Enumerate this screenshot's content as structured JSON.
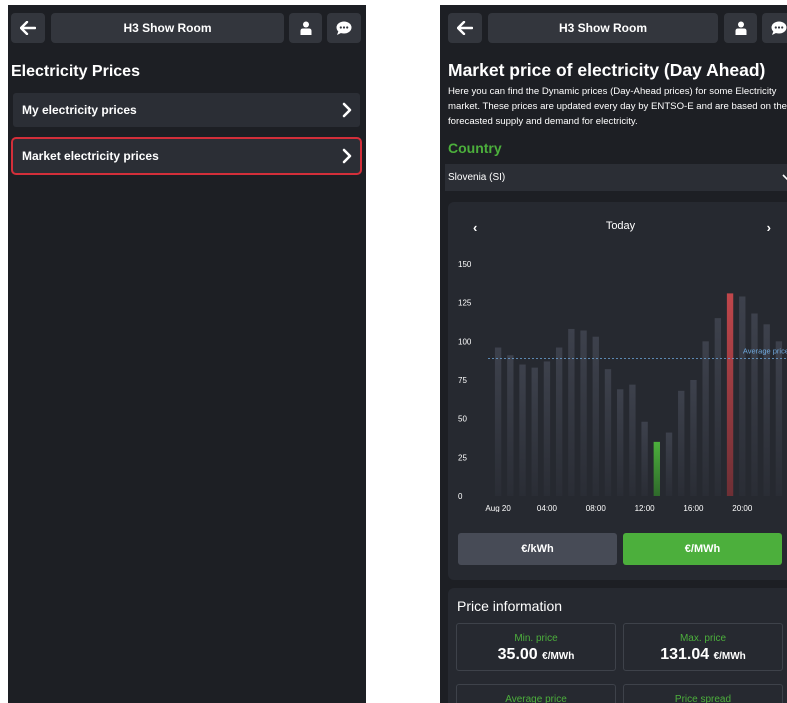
{
  "left_screen": {
    "header": {
      "title": "H3 Show Room"
    },
    "page_title": "Electricity Prices",
    "menu": [
      {
        "label": "My electricity prices"
      },
      {
        "label": "Market electricity prices"
      }
    ]
  },
  "right_screen": {
    "header": {
      "title": "H3 Show Room"
    },
    "page_title": "Market price of electricity (Day Ahead)",
    "description": "Here you can find the Dynamic prices (Day-Ahead prices) for some Electricity market. These prices are updated every day by ENTSO-E and are based on the forecasted supply and demand for electricity.",
    "country_label": "Country",
    "country_value": "Slovenia (SI)",
    "chart_nav": {
      "prev": "‹",
      "title": "Today",
      "next": "›"
    },
    "unit_buttons": {
      "kwh": "€/kWh",
      "mwh": "€/MWh"
    },
    "price_info": {
      "title": "Price information",
      "min": {
        "label": "Min. price",
        "value": "35.00",
        "unit": "€/MWh"
      },
      "max": {
        "label": "Max. price",
        "value": "131.04",
        "unit": "€/MWh"
      },
      "avg": {
        "label": "Average price"
      },
      "spread": {
        "label": "Price spread"
      }
    },
    "colors": {
      "accent_green": "#4caf3c",
      "highlight_red": "#b23a3f",
      "bar": "#3a3e49",
      "selected_unit": "#4caf3c"
    }
  },
  "chart_data": {
    "type": "bar",
    "title": "Today",
    "x_tick_labels": [
      "Aug 20",
      "04:00",
      "08:00",
      "12:00",
      "16:00",
      "20:00"
    ],
    "x_tick_hours": [
      0,
      4,
      8,
      12,
      16,
      20
    ],
    "hours": [
      0,
      1,
      2,
      3,
      4,
      5,
      6,
      7,
      8,
      9,
      10,
      11,
      12,
      13,
      14,
      15,
      16,
      17,
      18,
      19,
      20,
      21,
      22,
      23
    ],
    "values": [
      96,
      91,
      85,
      83,
      87,
      96,
      108,
      107,
      103,
      82,
      69,
      72,
      48,
      35,
      41,
      68,
      75,
      100,
      115,
      131,
      129,
      118,
      111,
      100
    ],
    "ylim": [
      0,
      150
    ],
    "yticks": [
      0,
      25,
      50,
      75,
      100,
      125,
      150
    ],
    "average": {
      "label": "Average price",
      "value": 89
    },
    "highlight": {
      "min_index": 13,
      "max_index": 19
    },
    "grid": false
  }
}
